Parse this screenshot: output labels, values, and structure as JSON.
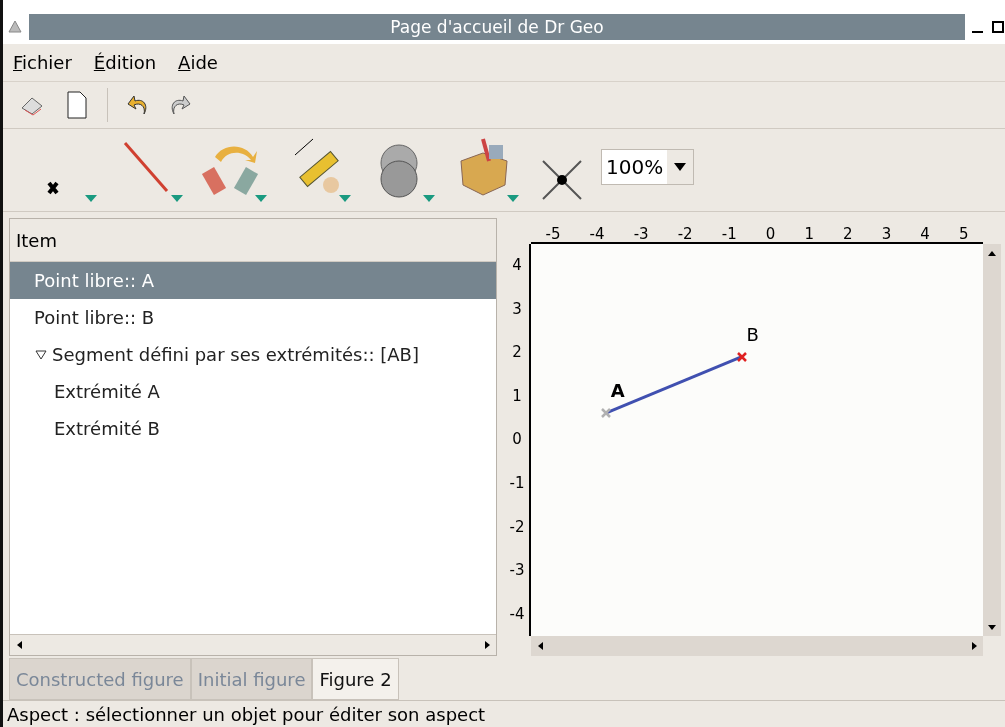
{
  "window": {
    "title": "Page d'accueil de Dr Geo"
  },
  "menu": [
    {
      "label": "Fichier"
    },
    {
      "label": "Édition"
    },
    {
      "label": "Aide"
    }
  ],
  "zoom": {
    "value": "100%"
  },
  "tree": {
    "header": "Item",
    "items": [
      {
        "label": "Point libre:: A",
        "selected": true
      },
      {
        "label": "Point libre:: B",
        "selected": false
      },
      {
        "label": "Segment défini par ses extrémités:: [AB]",
        "selected": false,
        "expanded": true,
        "children": [
          {
            "label": "Extrémité A",
            "selected": false
          },
          {
            "label": "Extrémité B",
            "selected": false
          }
        ]
      }
    ]
  },
  "canvas": {
    "hruler": [
      "-5",
      "-4",
      "-3",
      "-2",
      "-1",
      "0",
      "1",
      "2",
      "3",
      "4",
      "5"
    ],
    "vruler": [
      "4",
      "3",
      "2",
      "1",
      "0",
      "-1",
      "-2",
      "-3",
      "-4"
    ],
    "points": [
      {
        "name": "A",
        "color": "#b0b0b0"
      },
      {
        "name": "B",
        "color": "#e02020"
      }
    ]
  },
  "tabs": [
    {
      "label": "Constructed figure",
      "selected": false
    },
    {
      "label": "Initial figure",
      "selected": false
    },
    {
      "label": "Figure 2",
      "selected": true
    }
  ],
  "status": "Aspect : sélectionner un objet pour éditer son aspect"
}
